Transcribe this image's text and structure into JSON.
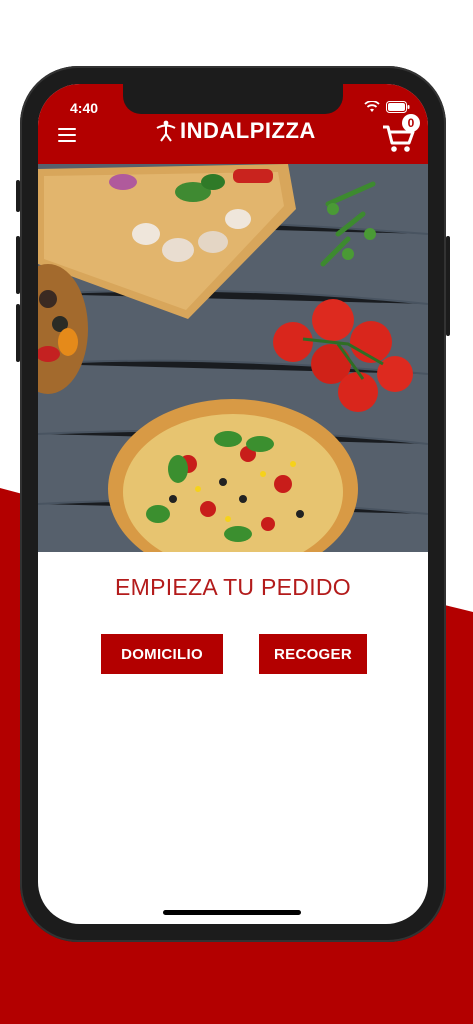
{
  "status": {
    "time": "4:40"
  },
  "header": {
    "brand": "INDALPIZZA",
    "cart_count": "0"
  },
  "main": {
    "title": "EMPIEZA TU PEDIDO",
    "delivery_label": "DOMICILIO",
    "pickup_label": "RECOGER"
  },
  "colors": {
    "brand": "#b30000",
    "title": "#b31b1b",
    "background": "#ffffff"
  },
  "icons": {
    "menu": "menu-icon",
    "cart": "shopping-cart-icon",
    "wifi": "wifi-icon",
    "battery": "battery-icon",
    "logo": "indalo-figure-icon"
  }
}
